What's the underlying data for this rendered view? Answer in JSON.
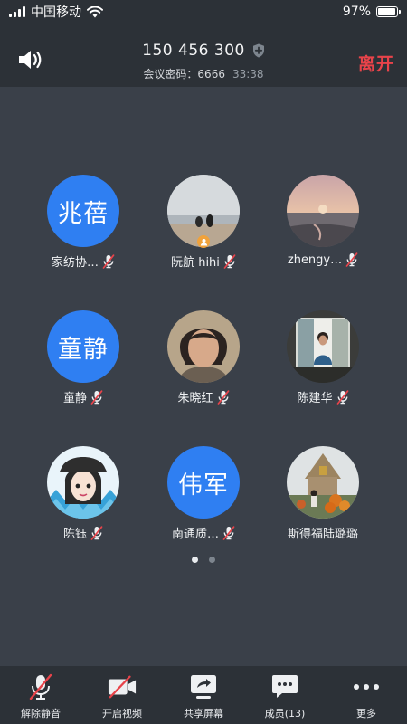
{
  "status_bar": {
    "carrier": "中国移动",
    "battery_text": "97%",
    "battery_level": 0.97
  },
  "header": {
    "meeting_id": "150 456 300",
    "password_label": "会议密码：6666",
    "timer": "33:38",
    "leave_label": "离开"
  },
  "participants": [
    {
      "name": "家纺协…",
      "avatar_text": "兆蓓",
      "avatar_type": "text"
    },
    {
      "name": "阮航 hihi",
      "avatar_type": "photo-beach-people",
      "host": true
    },
    {
      "name": "zhengy…",
      "avatar_type": "photo-sunset-sea"
    },
    {
      "name": "童静",
      "avatar_text": "童静",
      "avatar_type": "text"
    },
    {
      "name": "朱晓红",
      "avatar_type": "photo-woman-portrait"
    },
    {
      "name": "陈建华",
      "avatar_type": "photo-woman-window"
    },
    {
      "name": "陈钰",
      "avatar_type": "cartoon-girl-cap"
    },
    {
      "name": "南通质…",
      "avatar_text": "伟军",
      "avatar_type": "text"
    },
    {
      "name": "斯得福陆璐璐",
      "avatar_type": "photo-child-pumpkins"
    }
  ],
  "pager": {
    "pages": 2,
    "current": 1
  },
  "toolbar": {
    "unmute_label": "解除静音",
    "video_label": "开启视频",
    "share_label": "共享屏幕",
    "members_label": "成员(13)",
    "more_label": "更多"
  },
  "colors": {
    "background": "#3a4049",
    "bar": "#2c3137",
    "accent_blue": "#2f7ff2",
    "leave_red": "#e8434a",
    "mute_red": "#e8434a"
  }
}
